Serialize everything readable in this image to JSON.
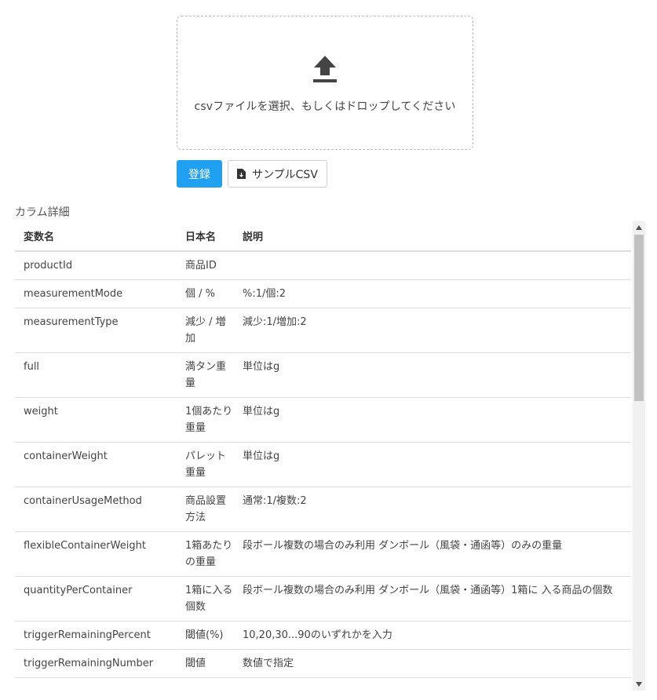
{
  "upload": {
    "icon": "upload-icon",
    "text": "csvファイルを選択、もしくはドロップしてください"
  },
  "buttons": {
    "register_label": "登録",
    "sample_label": "サンプルCSV",
    "sample_icon": "file-download-icon"
  },
  "colors": {
    "primary": "#20a0f0",
    "border": "#dddddd"
  },
  "table": {
    "section_title": "カラム詳細",
    "headers": [
      "変数名",
      "日本名",
      "説明"
    ],
    "rows": [
      [
        "productId",
        "商品ID",
        ""
      ],
      [
        "measurementMode",
        "個 / %",
        "%:1/個:2"
      ],
      [
        "measurementType",
        "減少 / 増加",
        "減少:1/増加:2"
      ],
      [
        "full",
        "満タン重量",
        "単位はg"
      ],
      [
        "weight",
        "1個あたり重量",
        "単位はg"
      ],
      [
        "containerWeight",
        "パレット重量",
        "単位はg"
      ],
      [
        "containerUsageMethod",
        "商品設置方法",
        "通常:1/複数:2"
      ],
      [
        "flexibleContainerWeight",
        "1箱あたりの重量",
        "段ボール複数の場合のみ利用 ダンボール（風袋・通函等）のみの重量"
      ],
      [
        "quantityPerContainer",
        "1箱に入る個数",
        "段ボール複数の場合のみ利用 ダンボール（風袋・通函等）1箱に 入る商品の個数"
      ],
      [
        "triggerRemainingPercent",
        "閾値(%)",
        "10,20,30...90のいずれかを入力"
      ],
      [
        "triggerRemainingNumber",
        "閾値",
        "数値で指定"
      ]
    ]
  }
}
